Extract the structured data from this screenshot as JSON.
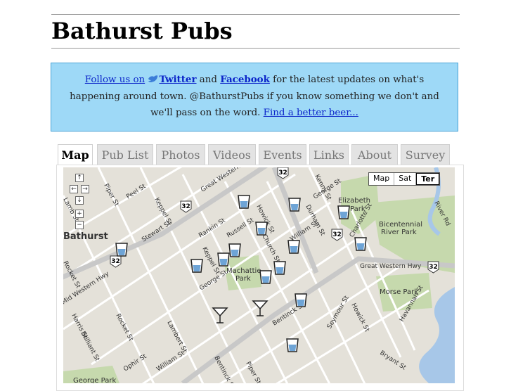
{
  "site": {
    "title": "Bathurst Pubs"
  },
  "notice": {
    "follow_prefix": "Follow us on",
    "twitter": "Twitter",
    "and": "and",
    "facebook": "Facebook",
    "middle": "for the latest updates on what's happening around town. @BathurstPubs if you know something we don't and we'll pass on the word.",
    "find_link": "Find a better beer..."
  },
  "tabs": [
    "Map",
    "Pub List",
    "Photos",
    "Videos",
    "Events",
    "Links",
    "About",
    "Survey"
  ],
  "map": {
    "type_buttons": [
      "Map",
      "Sat",
      "Ter"
    ],
    "selected_type": "Ter",
    "controls": {
      "pan_up": "↑",
      "pan_left": "←",
      "pan_right": "→",
      "pan_down": "↓",
      "zoom_in": "+",
      "zoom_out": "−"
    },
    "labels": {
      "bathurst": "Bathurst",
      "elizabeth_park": "Elizabeth Park",
      "elizabeth": "Elizabeth",
      "park": "Park",
      "bicentennial1": "Bicentennial",
      "bicentennial2": "River Park",
      "machattie1": "Machattie",
      "machattie2": "Park",
      "morse_park": "Morse Park",
      "george_park": "George Park",
      "mid_western": "Mid Western Hwy",
      "great_western_1": "Great Western",
      "great_western_2": "Great Western Hwy",
      "stewart": "Stewart St",
      "william_1": "William St",
      "william_2": "William St",
      "durham": "Durham St",
      "howick_1": "Howick St",
      "howick_2": "Howick St",
      "george_1": "George St",
      "george_2": "George St",
      "keppel_1": "Keppel St",
      "keppel_2": "Keppel St",
      "rankin": "Rankin St",
      "russell": "Russell St",
      "church": "Church St",
      "piper_1": "Piper St",
      "piper_2": "Piper St",
      "peel": "Peel St",
      "charlotte": "Charlotte St",
      "havannah": "Havannah St",
      "bentinck_1": "Bentinck St",
      "bentinck_2": "Bentinck St",
      "seymour": "Seymour St",
      "rocket_1": "Rocket St",
      "rocket_2": "Rocket St",
      "lambert": "Lambert St",
      "ophir": "Ophir St",
      "harris": "Harris St",
      "brilliant": "Brilliant St",
      "bryant": "Bryant St",
      "river_rd": "River Rd",
      "kenny": "Kenny St",
      "lamb": "Lamb St",
      "hwy_32": "32"
    },
    "pub_markers": [
      "beer-glass",
      "beer-glass",
      "beer-glass",
      "beer-glass",
      "beer-glass",
      "beer-glass",
      "beer-glass",
      "beer-glass",
      "beer-glass",
      "beer-glass",
      "beer-glass",
      "beer-glass",
      "cocktail",
      "cocktail"
    ],
    "colors": {
      "road_major": "#ffffff",
      "road_highway": "#c8c8c8",
      "park": "#c6d9ad",
      "river": "#a7c7e8",
      "land": "#e4e1d9"
    }
  }
}
